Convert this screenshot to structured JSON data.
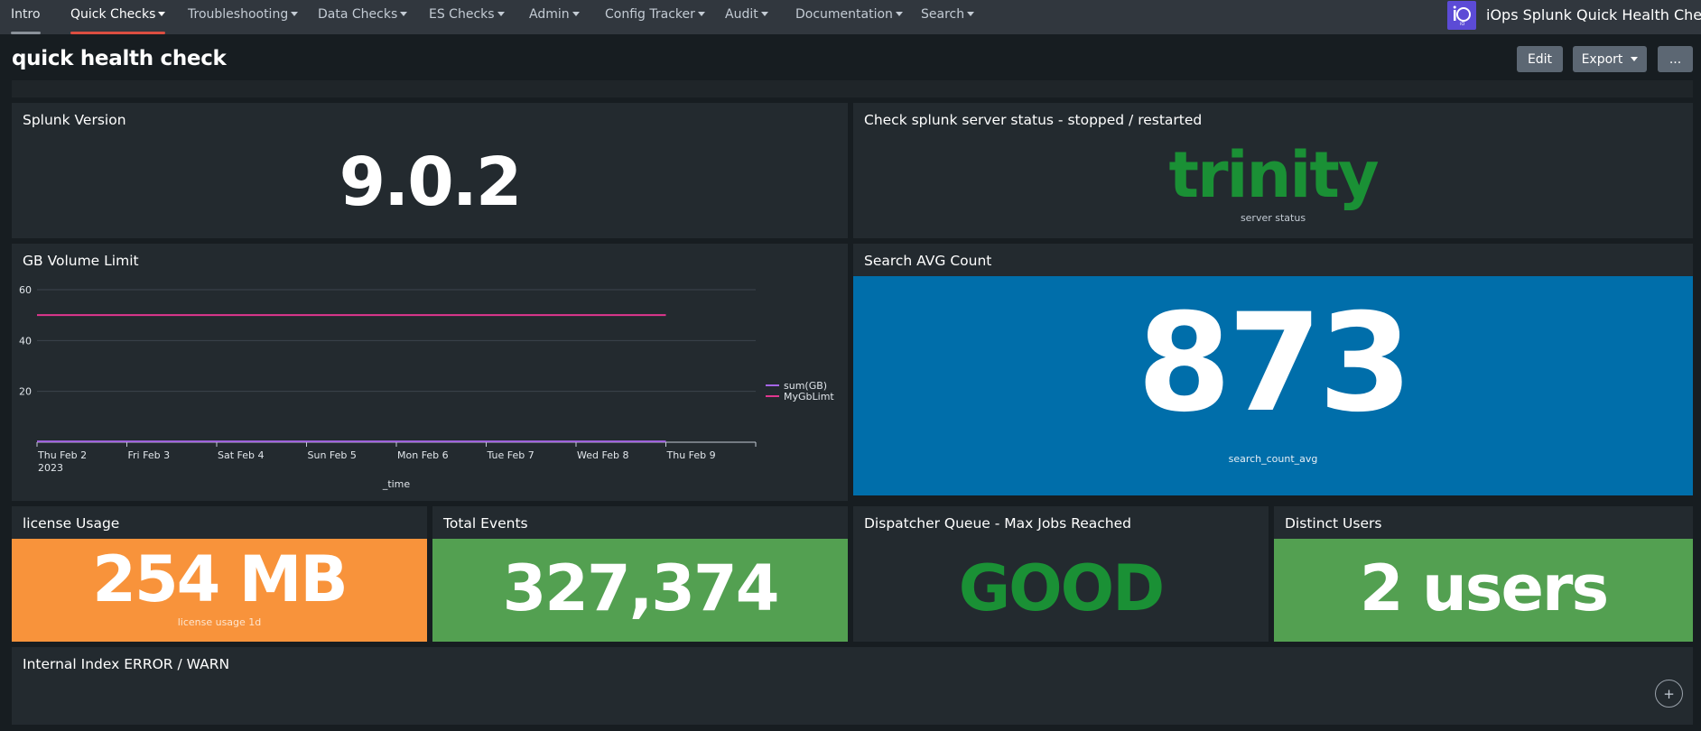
{
  "nav": {
    "items": [
      {
        "label": "Intro",
        "caret": false
      },
      {
        "label": "Quick Checks",
        "caret": true
      },
      {
        "label": "Troubleshooting",
        "caret": true
      },
      {
        "label": "Data Checks",
        "caret": true
      },
      {
        "label": "ES Checks",
        "caret": true
      },
      {
        "label": "Admin",
        "caret": true
      },
      {
        "label": "Config Tracker",
        "caret": true
      },
      {
        "label": "Audit",
        "caret": true
      },
      {
        "label": "Documentation",
        "caret": true
      },
      {
        "label": "Search",
        "caret": true
      }
    ],
    "active": "Quick Checks",
    "app_logo_text": "iO",
    "app_title": "iOps Splunk Quick Health Check"
  },
  "page": {
    "title": "quick health check",
    "buttons": {
      "edit": "Edit",
      "export": "Export",
      "more": "..."
    }
  },
  "panels": {
    "splunk_version": {
      "title": "Splunk Version",
      "value": "9.0.2"
    },
    "server_status": {
      "title": "Check splunk server status - stopped / restarted",
      "value": "trinity",
      "under_label": "server status",
      "value_color": "#1a9035"
    },
    "gb_volume": {
      "title": "GB Volume Limit"
    },
    "search_avg": {
      "title": "Search AVG Count",
      "value": "873",
      "under_label": "search_count_avg",
      "bg_color": "#006eaa"
    },
    "license_usage": {
      "title": "license Usage",
      "value": "254 MB",
      "under_label": "license usage 1d",
      "bg_color": "#f8933b"
    },
    "total_events": {
      "title": "Total Events",
      "value": "327,374",
      "bg_color": "#53a051"
    },
    "dispatcher_queue": {
      "title": "Dispatcher Queue - Max Jobs Reached",
      "value": "GOOD",
      "value_color": "#1a9035"
    },
    "distinct_users": {
      "title": "Distinct Users",
      "value": "2 users",
      "bg_color": "#53a051"
    },
    "internal_index": {
      "title": "Internal Index ERROR / WARN",
      "expand_label": "+"
    }
  },
  "chart_data": {
    "type": "line",
    "x": [
      "Thu Feb 2\n2023",
      "Fri Feb 3",
      "Sat Feb 4",
      "Sun Feb 5",
      "Mon Feb 6",
      "Tue Feb 7",
      "Wed Feb 8",
      "Thu Feb 9"
    ],
    "series": [
      {
        "name": "sum(GB)",
        "values": [
          0.3,
          0.3,
          0.3,
          0.3,
          0.3,
          0.3,
          0.3,
          0.3
        ],
        "color": "#a565e6"
      },
      {
        "name": "MyGbLimt",
        "values": [
          50,
          50,
          50,
          50,
          50,
          50,
          50,
          50
        ],
        "color": "#e0368e"
      }
    ],
    "xlabel": "_time",
    "ylabel": "",
    "ylim": [
      0,
      60
    ],
    "yticks": [
      20,
      40,
      60
    ],
    "grid": true,
    "legend": "right"
  }
}
